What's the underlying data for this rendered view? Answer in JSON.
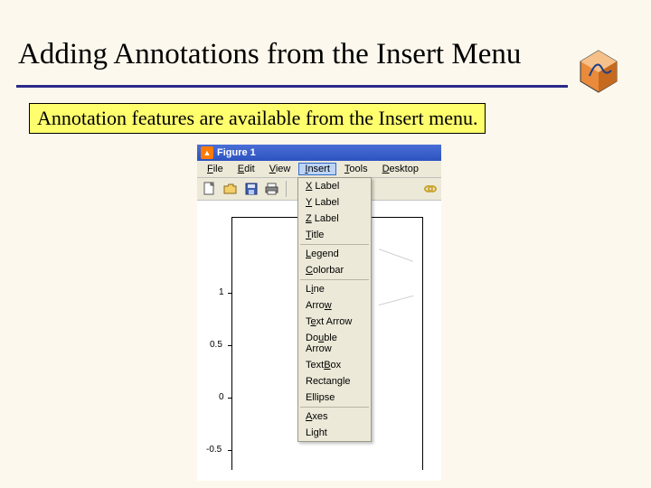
{
  "title": "Adding Annotations from the Insert Menu",
  "callout": "Annotation features are available from the Insert menu.",
  "window": {
    "title": "Figure 1"
  },
  "menu": {
    "file": "File",
    "edit": "Edit",
    "view": "View",
    "insert": "Insert",
    "tools": "Tools",
    "desktop": "Desktop"
  },
  "insert_menu": {
    "xlabel": "X Label",
    "ylabel": "Y Label",
    "zlabel": "Z Label",
    "title": "Title",
    "legend": "Legend",
    "colorbar": "Colorbar",
    "line": "Line",
    "arrow": "Arrow",
    "textarrow": "Text Arrow",
    "doublearrow": "Double Arrow",
    "textbox": "TextBox",
    "rectangle": "Rectangle",
    "ellipse": "Ellipse",
    "axes": "Axes",
    "light": "Light"
  },
  "axis": {
    "t1": "1",
    "t2": "0.5",
    "t3": "0",
    "t4": "-0.5"
  },
  "icons": {
    "new": "new",
    "open": "open",
    "save": "save",
    "print": "print",
    "link": "link"
  }
}
